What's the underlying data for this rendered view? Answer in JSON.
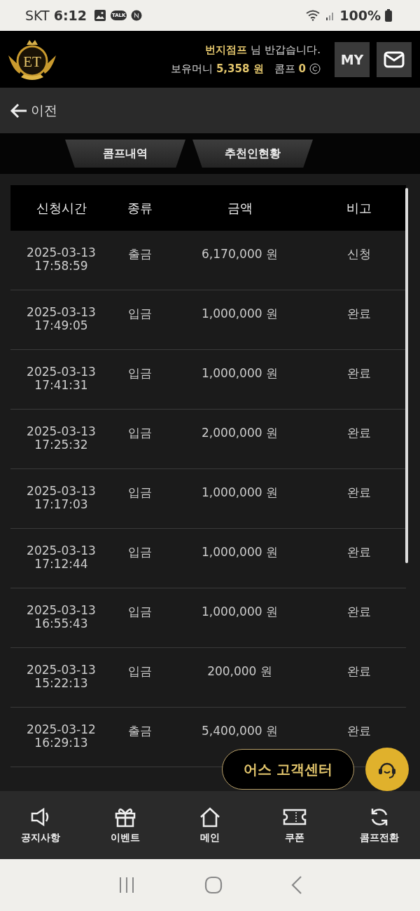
{
  "status_bar": {
    "carrier": "SKT",
    "time": "6:12",
    "notif_badge": "TALK",
    "battery": "100%"
  },
  "header": {
    "logo": "ET",
    "user": "번지점프",
    "greeting": "님 반갑습니다.",
    "money_label": "보유머니",
    "money": "5,358 원",
    "comp_label": "콤프",
    "comp": "0",
    "my_button": "MY"
  },
  "back": {
    "label": "이전"
  },
  "tabs": [
    {
      "label": "콤프내역"
    },
    {
      "label": "추천인현황"
    }
  ],
  "table": {
    "columns": [
      "신청시간",
      "종류",
      "금액",
      "비고"
    ],
    "rows": [
      {
        "date": "2025-03-13",
        "time": "17:58:59",
        "type": "출금",
        "amount": "6,170,000 원",
        "note": "신청"
      },
      {
        "date": "2025-03-13",
        "time": "17:49:05",
        "type": "입금",
        "amount": "1,000,000 원",
        "note": "완료"
      },
      {
        "date": "2025-03-13",
        "time": "17:41:31",
        "type": "입금",
        "amount": "1,000,000 원",
        "note": "완료"
      },
      {
        "date": "2025-03-13",
        "time": "17:25:32",
        "type": "입금",
        "amount": "2,000,000 원",
        "note": "완료"
      },
      {
        "date": "2025-03-13",
        "time": "17:17:03",
        "type": "입금",
        "amount": "1,000,000 원",
        "note": "완료"
      },
      {
        "date": "2025-03-13",
        "time": "17:12:44",
        "type": "입금",
        "amount": "1,000,000 원",
        "note": "완료"
      },
      {
        "date": "2025-03-13",
        "time": "16:55:43",
        "type": "입금",
        "amount": "1,000,000 원",
        "note": "완료"
      },
      {
        "date": "2025-03-13",
        "time": "15:22:13",
        "type": "입금",
        "amount": "200,000 원",
        "note": "완료"
      },
      {
        "date": "2025-03-12",
        "time": "16:29:13",
        "type": "출금",
        "amount": "5,400,000 원",
        "note": "완료"
      }
    ]
  },
  "support_button": "어스 고객센터",
  "bottom_nav": [
    {
      "label": "공지사항",
      "kind": "speaker"
    },
    {
      "label": "이벤트",
      "kind": "gift"
    },
    {
      "label": "메인",
      "kind": "home"
    },
    {
      "label": "쿠폰",
      "kind": "ticket"
    },
    {
      "label": "콤프전환",
      "kind": "refresh"
    }
  ]
}
